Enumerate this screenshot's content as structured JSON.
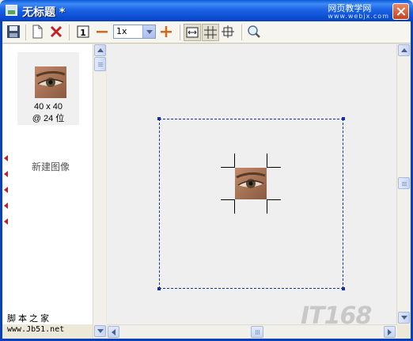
{
  "window": {
    "title": "无标题 *",
    "watermark_cn": "网页教学网",
    "watermark_url": "www.webjx.com"
  },
  "toolbar": {
    "buttons": [
      "save-icon",
      "new-page-icon",
      "delete-icon",
      "actual-size-icon",
      "zoom-out-icon",
      "zoom-in-icon",
      "fit-width-icon",
      "grid-icon",
      "crosshair-icon",
      "magnifier-icon"
    ],
    "zoom_value": "1x"
  },
  "thumbnail": {
    "size": "40 x 40",
    "depth": "@ 24 位"
  },
  "left_panel": {
    "new_image_label": "新建图像",
    "watermark_site": "脚本之家",
    "watermark_url": "www.Jb51.net"
  },
  "canvas": {
    "watermark": "IT168"
  },
  "colors": {
    "titlebar": "#0a5ad8",
    "selection": "#1530a8",
    "arrow_marker": "#b62525"
  }
}
